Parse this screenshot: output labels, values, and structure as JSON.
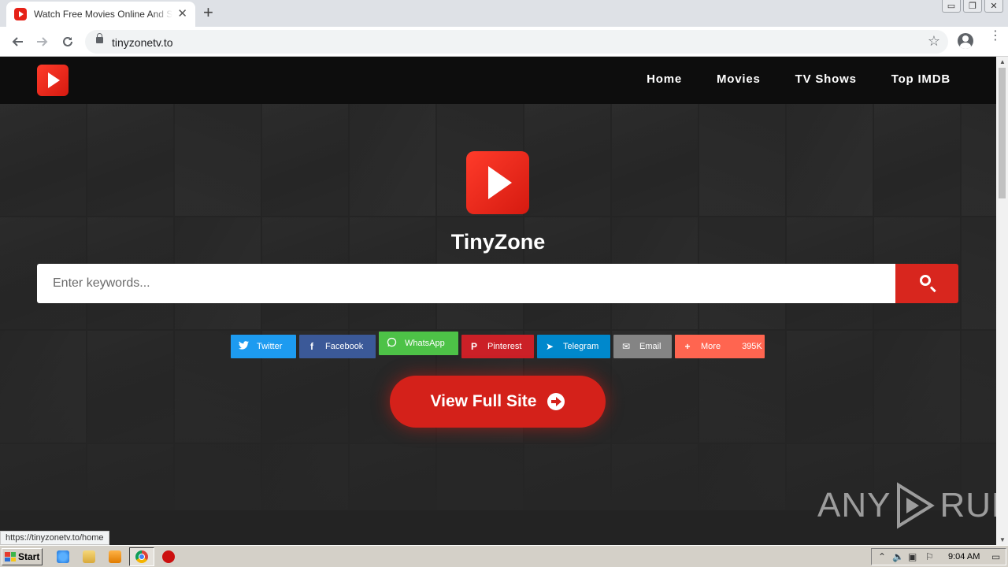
{
  "browser": {
    "tab_title": "Watch Free Movies Online And Stream",
    "tab_close": "✕",
    "new_tab": "+",
    "url": "tinyzonetv.to",
    "window_controls": [
      "▭",
      "❐",
      "✕"
    ]
  },
  "site": {
    "nav": [
      "Home",
      "Movies",
      "TV Shows",
      "Top IMDB"
    ],
    "title": "TinyZone",
    "search_placeholder": "Enter keywords...",
    "share": [
      {
        "label": "Twitter",
        "icon": "🐦",
        "color": "#1d9bf0"
      },
      {
        "label": "Facebook",
        "icon": "f",
        "color": "#3b5998"
      },
      {
        "label": "WhatsApp",
        "icon": "◌",
        "color": "#4dc247"
      },
      {
        "label": "Pinterest",
        "icon": "P",
        "color": "#cb2027"
      },
      {
        "label": "Telegram",
        "icon": "➤",
        "color": "#0088cc"
      },
      {
        "label": "Email",
        "icon": "✉",
        "color": "#848484"
      },
      {
        "label": "More",
        "icon": "+",
        "color": "#ff6550",
        "count": "395K"
      }
    ],
    "cta_label": "View Full Site"
  },
  "watermark": {
    "left": "ANY",
    "right": "RUN"
  },
  "status_url": "https://tinyzonetv.to/home",
  "taskbar": {
    "start_label": "Start",
    "clock": "9:04 AM"
  }
}
